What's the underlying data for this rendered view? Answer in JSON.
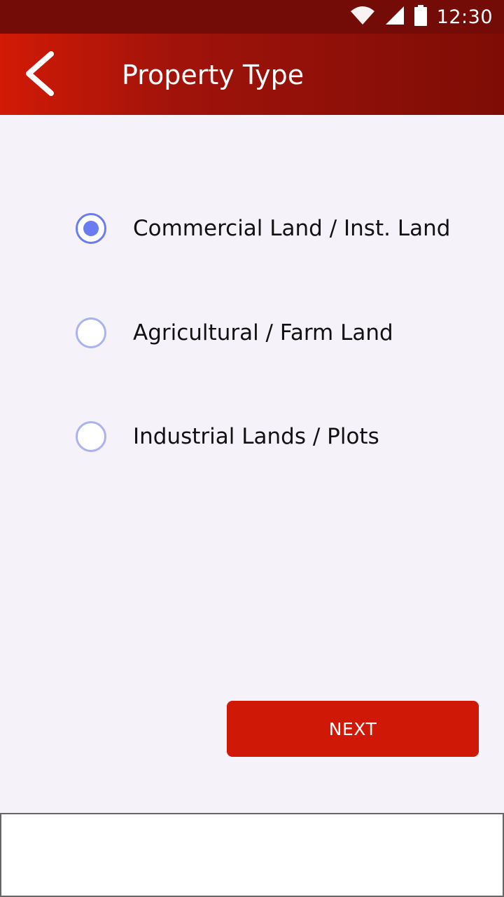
{
  "status_bar": {
    "time": "12:30",
    "icons": [
      "wifi-icon",
      "cell-signal-icon",
      "battery-icon"
    ]
  },
  "app_bar": {
    "back_icon": "chevron-left-icon",
    "title": "Property Type"
  },
  "property_options": [
    {
      "label": "Commercial Land / Inst. Land",
      "checked": true
    },
    {
      "label": "Agricultural / Farm Land",
      "checked": false
    },
    {
      "label": "Industrial Lands / Plots",
      "checked": false
    }
  ],
  "next_button": {
    "label": "NEXT"
  },
  "colors": {
    "status_bar": "#730b06",
    "app_bar_start": "#d21a06",
    "app_bar_end": "#7e0d06",
    "radio_accent": "#6b7cf0",
    "radio_unchecked": "#aab2f0",
    "button": "#d01806",
    "background": "#f5f3f9"
  }
}
